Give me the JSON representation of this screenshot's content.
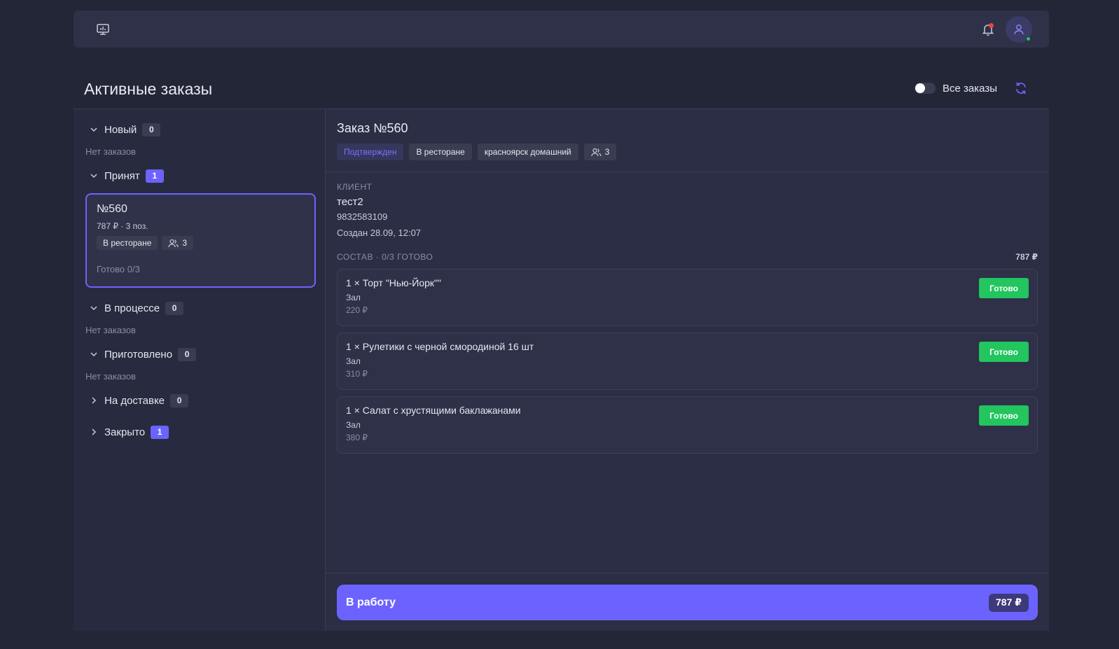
{
  "header": {
    "monitor_icon": "monitor-icon",
    "bell_icon": "bell-icon",
    "avatar_icon": "user-icon"
  },
  "page": {
    "title": "Активные заказы",
    "toggle_label": "Все заказы",
    "toggle_on": false
  },
  "groups": [
    {
      "label": "Новый",
      "count": "0",
      "expanded": true,
      "empty_text": "Нет заказов"
    },
    {
      "label": "Принят",
      "count": "1",
      "expanded": true
    },
    {
      "label": "В процессе",
      "count": "0",
      "expanded": true,
      "empty_text": "Нет заказов"
    },
    {
      "label": "Приготовлено",
      "count": "0",
      "expanded": true,
      "empty_text": "Нет заказов"
    },
    {
      "label": "На доставке",
      "count": "0",
      "expanded": false
    },
    {
      "label": "Закрыто",
      "count": "1",
      "expanded": false
    }
  ],
  "order_card": {
    "number": "№560",
    "meta": "787 ₽ · 3 поз.",
    "location": "В ресторане",
    "guests": "3",
    "ready": "Готово 0/3"
  },
  "order": {
    "title": "Заказ №560",
    "status": "Подтвержден",
    "location": "В ресторане",
    "restaurant": "красноярск домашний",
    "guests": "3",
    "client_label": "КЛИЕНТ",
    "client_name": "тест2",
    "client_phone": "9832583109",
    "created": "Создан 28.09, 12:07",
    "composition_label": "СОСТАВ · 0/3 ГОТОВО",
    "total": "787 ₽",
    "items": [
      {
        "name": "1 × Торт \"Нью-Йорк\"\"",
        "place": "Зал",
        "price": "220 ₽",
        "button": "Готово"
      },
      {
        "name": "1 × Рулетики с черной смородиной 16 шт",
        "place": "Зал",
        "price": "310 ₽",
        "button": "Готово"
      },
      {
        "name": "1 × Салат с хрустящими баклажанами",
        "place": "Зал",
        "price": "380 ₽",
        "button": "Готово"
      }
    ],
    "action_label": "В работу",
    "action_total": "787 ₽"
  },
  "colors": {
    "accent": "#6c63ff",
    "success": "#22c55e",
    "background": "#232637",
    "panel": "#2b2e44"
  }
}
